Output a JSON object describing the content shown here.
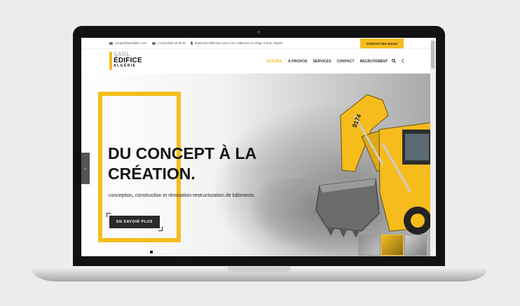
{
  "topbar": {
    "email": "contact@sarledifice.com",
    "phone": "(+213) 0553 48 65 62",
    "address": "Boulevard millénium zone 5 lot 1 bâtiment A2, étage 3 Oran, Algérie.",
    "cta": "CONTACTEZ-NOUS"
  },
  "logo": {
    "sarl": "SARL",
    "name": "ÉDIFICE",
    "country": "ALGÉRIE"
  },
  "nav": {
    "items": [
      "ACCUEIL",
      "À PROPOS",
      "SERVICES",
      "CONTACT",
      "RECRUTEMENT"
    ]
  },
  "hero": {
    "title_line1": "DU CONCEPT À LA",
    "title_line2": "CRÉATION.",
    "subtitle": "conception, construction et rénovation-restructuration de bâtiments.",
    "button": "EN SAVOIR PLUS",
    "excavator_text": "9174"
  },
  "colors": {
    "accent": "#f5bc1b",
    "dark": "#151515",
    "button": "#2a2a2a"
  },
  "icons": [
    "envelope-icon",
    "phone-icon",
    "map-pin-icon",
    "search-icon",
    "half-circle-icon",
    "chevron-left-icon",
    "chevron-right-icon"
  ]
}
